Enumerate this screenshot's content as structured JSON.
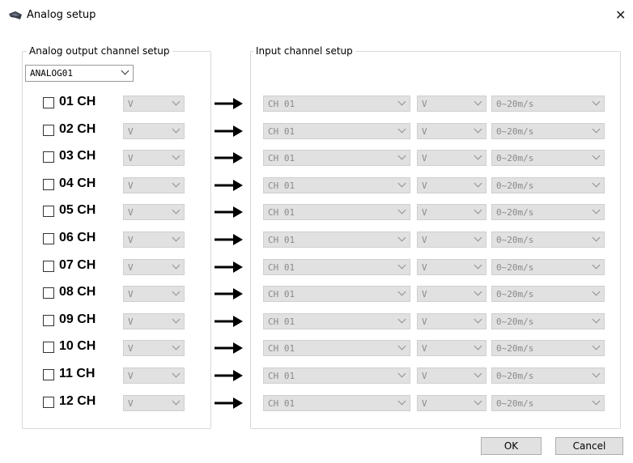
{
  "window": {
    "title": "Analog setup"
  },
  "output_group": {
    "label": "Analog output channel setup",
    "selected_device": "ANALOG01"
  },
  "input_group": {
    "label": "Input channel setup"
  },
  "channels": [
    {
      "label": "01 CH",
      "checked": false,
      "unit": "V",
      "input_channel": "CH 01",
      "input_unit": "V",
      "range": "0~20m/s"
    },
    {
      "label": "02 CH",
      "checked": false,
      "unit": "V",
      "input_channel": "CH 01",
      "input_unit": "V",
      "range": "0~20m/s"
    },
    {
      "label": "03 CH",
      "checked": false,
      "unit": "V",
      "input_channel": "CH 01",
      "input_unit": "V",
      "range": "0~20m/s"
    },
    {
      "label": "04 CH",
      "checked": false,
      "unit": "V",
      "input_channel": "CH 01",
      "input_unit": "V",
      "range": "0~20m/s"
    },
    {
      "label": "05 CH",
      "checked": false,
      "unit": "V",
      "input_channel": "CH 01",
      "input_unit": "V",
      "range": "0~20m/s"
    },
    {
      "label": "06 CH",
      "checked": false,
      "unit": "V",
      "input_channel": "CH 01",
      "input_unit": "V",
      "range": "0~20m/s"
    },
    {
      "label": "07 CH",
      "checked": false,
      "unit": "V",
      "input_channel": "CH 01",
      "input_unit": "V",
      "range": "0~20m/s"
    },
    {
      "label": "08 CH",
      "checked": false,
      "unit": "V",
      "input_channel": "CH 01",
      "input_unit": "V",
      "range": "0~20m/s"
    },
    {
      "label": "09 CH",
      "checked": false,
      "unit": "V",
      "input_channel": "CH 01",
      "input_unit": "V",
      "range": "0~20m/s"
    },
    {
      "label": "10 CH",
      "checked": false,
      "unit": "V",
      "input_channel": "CH 01",
      "input_unit": "V",
      "range": "0~20m/s"
    },
    {
      "label": "11 CH",
      "checked": false,
      "unit": "V",
      "input_channel": "CH 01",
      "input_unit": "V",
      "range": "0~20m/s"
    },
    {
      "label": "12 CH",
      "checked": false,
      "unit": "V",
      "input_channel": "CH 01",
      "input_unit": "V",
      "range": "0~20m/s"
    }
  ],
  "buttons": {
    "ok": "OK",
    "cancel": "Cancel"
  },
  "colors": {
    "disabled_field": "#e1e1e1",
    "disabled_text": "#8a8a8a",
    "frame": "#d8d8d8"
  },
  "icons": {
    "app": "lens-icon",
    "close": "close-icon",
    "arrow": "right-arrow-icon",
    "dropdown": "chevron-down-icon"
  }
}
